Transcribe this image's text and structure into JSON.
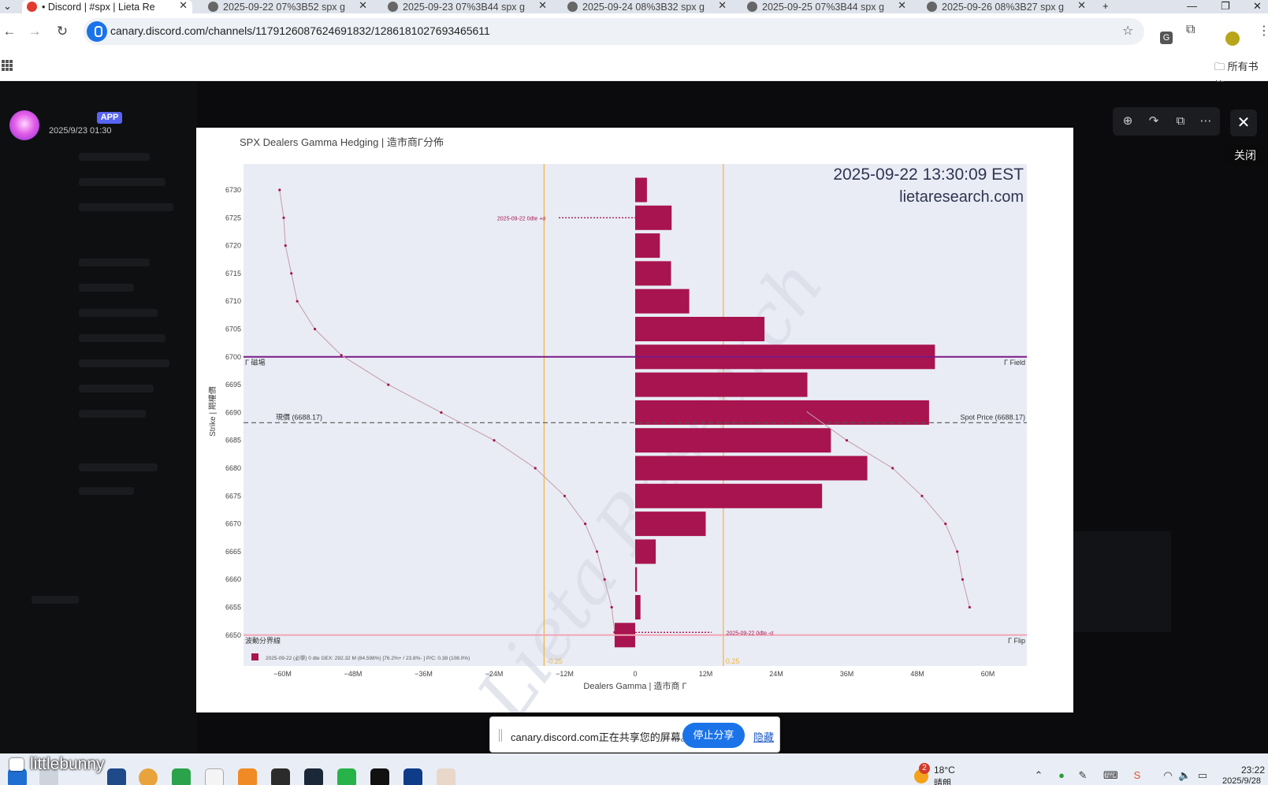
{
  "browser": {
    "tabs": [
      {
        "title": "• Discord | #spx | Lieta Re",
        "active": true
      },
      {
        "title": "2025-09-22 07%3B52 spx g",
        "active": false
      },
      {
        "title": "2025-09-23 07%3B44 spx g",
        "active": false
      },
      {
        "title": "2025-09-24 08%3B32 spx g",
        "active": false
      },
      {
        "title": "2025-09-25 07%3B44 spx g",
        "active": false
      },
      {
        "title": "2025-09-26 08%3B27 spx g",
        "active": false
      }
    ],
    "url": "canary.discord.com/channels/1179126087624691832/1286181027693465611",
    "all_bookmarks_label": "所有书签"
  },
  "message": {
    "app_badge": "APP",
    "timestamp": "2025/9/23 01:30"
  },
  "viewer": {
    "close_tooltip": "关闭"
  },
  "chart_data": {
    "type": "bar",
    "orientation": "horizontal",
    "title": "SPX Dealers Gamma Hedging | 造市商Γ分佈",
    "timestamp_text": "2025-09-22 13:30:09 EST",
    "site_text": "lietaresearch.com",
    "xlabel": "Dealers Gamma | 造市商 Γ",
    "ylabel": "Strike | 期權價",
    "x_tick_labels": [
      "−60M",
      "−48M",
      "−36M",
      "−24M",
      "−12M",
      "0",
      "12M",
      "24M",
      "36M",
      "48M",
      "60M"
    ],
    "xlim": [
      -65,
      67
    ],
    "ylim": [
      6646,
      6734
    ],
    "categories": [
      6730,
      6725,
      6720,
      6715,
      6710,
      6705,
      6700,
      6695,
      6690,
      6685,
      6680,
      6675,
      6670,
      6665,
      6660,
      6655,
      6650
    ],
    "series": [
      {
        "name": "2025-09-22 (必學)",
        "values": [
          2.0,
          6.2,
          4.2,
          6.1,
          9.2,
          22.0,
          51.0,
          29.3,
          50.0,
          33.3,
          39.5,
          31.8,
          12.0,
          3.5,
          0.3,
          0.9,
          -3.5
        ],
        "color": "#a8144f"
      }
    ],
    "curve_points": [
      [
        -60.5,
        6730
      ],
      [
        -59.8,
        6725
      ],
      [
        -59.5,
        6720
      ],
      [
        -58.5,
        6715
      ],
      [
        -57.5,
        6710
      ],
      [
        -54.5,
        6705
      ],
      [
        -50,
        6700.3
      ],
      [
        -42,
        6695
      ],
      [
        -33,
        6690
      ],
      [
        -24,
        6685
      ],
      [
        -17,
        6680
      ],
      [
        -12,
        6675
      ],
      [
        -8.5,
        6670
      ],
      [
        -6.5,
        6665
      ],
      [
        -5.2,
        6660
      ],
      [
        -4,
        6655
      ],
      [
        -3.5,
        6650.5
      ],
      [
        29,
        6650
      ],
      [
        56.8,
        6650
      ],
      [
        56.9,
        6655
      ],
      [
        55.7,
        6660
      ],
      [
        54.8,
        6665
      ],
      [
        52.8,
        6670
      ],
      [
        48.8,
        6675
      ],
      [
        43.8,
        6680
      ],
      [
        36,
        6685
      ],
      [
        29,
        6690.3
      ]
    ],
    "hlines": [
      {
        "y": 6700,
        "label_left": "Γ 磁場",
        "label_right": "Γ Field",
        "color": "#7a1a86",
        "style": "solid"
      },
      {
        "y": 6688.17,
        "label_left": "現價 (6688.17)",
        "label_right": "Spot Price (6688.17)",
        "color": "#555",
        "style": "dashed"
      },
      {
        "y": 6650,
        "label_left": "波動分界線",
        "label_right": "Γ Flip",
        "color": "#f2a6b6",
        "style": "solid"
      }
    ],
    "vlines": [
      {
        "x": -15.5,
        "label": "-0.25",
        "color": "#f0b43c"
      },
      {
        "x": 15.0,
        "label": "0.25",
        "color": "#f0b43c"
      }
    ],
    "annotations": [
      {
        "y": 6725,
        "x": -16,
        "text": "2025-09-22 0dte +σ"
      },
      {
        "y": 6650.5,
        "x": 16,
        "text": "2025-09-22 0dte -σ"
      }
    ],
    "legend_text": "2025-09-22 (必學)    0 dte    GEX: 292.32 M (84.598%)    [76.2%+ / 23.8%- ]    P/C: 0.38  (108.0%)",
    "watermark": "Lieta Research",
    "legend_position": "bottom-left"
  },
  "sharebar": {
    "text": "canary.discord.com正在共享您的屏幕。",
    "stop_label": "停止分享",
    "hide_label": "隐藏"
  },
  "taskbar": {
    "user_label": "littlebunny",
    "weather_badge": "2",
    "weather_temp": "18°C",
    "weather_desc": "晴朗",
    "clock_time": "23:22",
    "clock_date": "2025/9/28"
  }
}
